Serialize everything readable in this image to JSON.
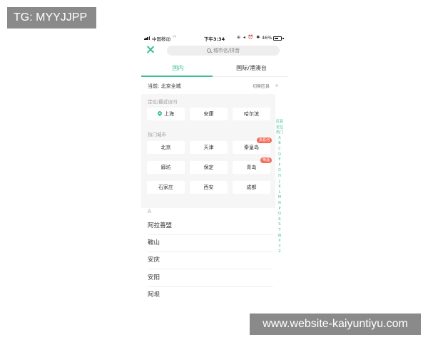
{
  "watermarks": {
    "top_left": "TG: MYYJJPP",
    "bottom_right": "www.website-kaiyuntiyu.com"
  },
  "status_bar": {
    "carrier": "中国移动",
    "wifi_icon": "wifi-icon",
    "time": "下午3:34",
    "icons": "⊕ ◂ ⏰ ✱",
    "battery_percent": "46%"
  },
  "header": {
    "close_icon": "close-icon",
    "search_placeholder": "城市名/拼音"
  },
  "tabs": [
    {
      "label": "国内",
      "active": true
    },
    {
      "label": "国际/港澳台",
      "active": false
    }
  ],
  "current": {
    "label": "当前: 北京全城",
    "switch_label": "切换区县"
  },
  "sections": {
    "recent_title": "定位/最近访问",
    "hot_title": "热门城市",
    "alpha_header": "A"
  },
  "recent_cities": [
    "上海",
    "安康",
    "哈尔滨"
  ],
  "hot_cities": [
    {
      "name": "北京",
      "badge": ""
    },
    {
      "name": "天津",
      "badge": ""
    },
    {
      "name": "秦皇岛",
      "badge": "去看河"
    },
    {
      "name": "廊坊",
      "badge": ""
    },
    {
      "name": "保定",
      "badge": ""
    },
    {
      "name": "青岛",
      "badge": "啤酒"
    },
    {
      "name": "石家庄",
      "badge": ""
    },
    {
      "name": "西安",
      "badge": ""
    },
    {
      "name": "成都",
      "badge": ""
    }
  ],
  "a_cities": [
    "阿拉善盟",
    "鞍山",
    "安庆",
    "安阳",
    "阿坝"
  ],
  "index_bar": [
    "区县",
    "定位",
    "热门",
    "A",
    "B",
    "C",
    "D",
    "E",
    "F",
    "G",
    "H",
    "J",
    "K",
    "L",
    "M",
    "N",
    "P",
    "Q",
    "R",
    "S",
    "T",
    "W",
    "X",
    "Y",
    "Z"
  ],
  "colors": {
    "accent": "#3cbf98",
    "badge": "#f36c5a",
    "section_bg": "#f6f6f6"
  }
}
